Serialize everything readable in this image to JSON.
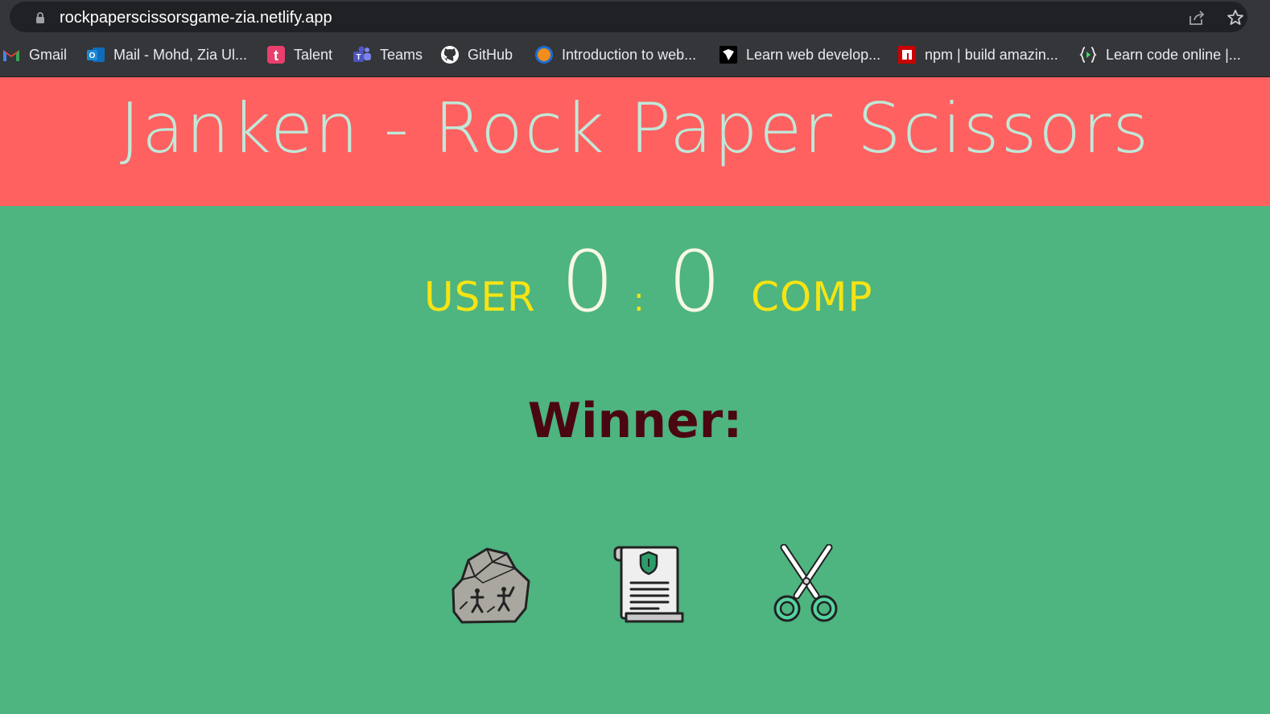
{
  "browser": {
    "url": "rockpaperscissorsgame-zia.netlify.app",
    "bookmarks": [
      {
        "label": "Gmail",
        "icon": "gmail-icon"
      },
      {
        "label": "Mail - Mohd, Zia Ul...",
        "icon": "outlook-icon"
      },
      {
        "label": "Talent",
        "icon": "talent-icon"
      },
      {
        "label": "Teams",
        "icon": "teams-icon"
      },
      {
        "label": "GitHub",
        "icon": "github-icon"
      },
      {
        "label": "Introduction to web...",
        "icon": "web-course-icon"
      },
      {
        "label": "Learn web develop...",
        "icon": "mdn-icon"
      },
      {
        "label": "npm | build amazin...",
        "icon": "npm-icon"
      },
      {
        "label": "Learn code online |...",
        "icon": "code-icon"
      }
    ]
  },
  "page": {
    "title": "Janken - Rock Paper Scissors",
    "user_label": "USER",
    "comp_label": "COMP",
    "user_score": "0",
    "comp_score": "0",
    "separator": ":",
    "winner_label": "Winner:",
    "choices": [
      {
        "name": "rock",
        "icon": "rock-icon"
      },
      {
        "name": "paper",
        "icon": "paper-icon"
      },
      {
        "name": "scissors",
        "icon": "scissors-icon"
      }
    ]
  },
  "colors": {
    "header_bg": "#ff6161",
    "title_color": "#bfe9d9",
    "body_bg": "#4eb480",
    "badge_color": "#f6e414",
    "score_color": "#f7f7e6",
    "winner_color": "#4a0712"
  }
}
